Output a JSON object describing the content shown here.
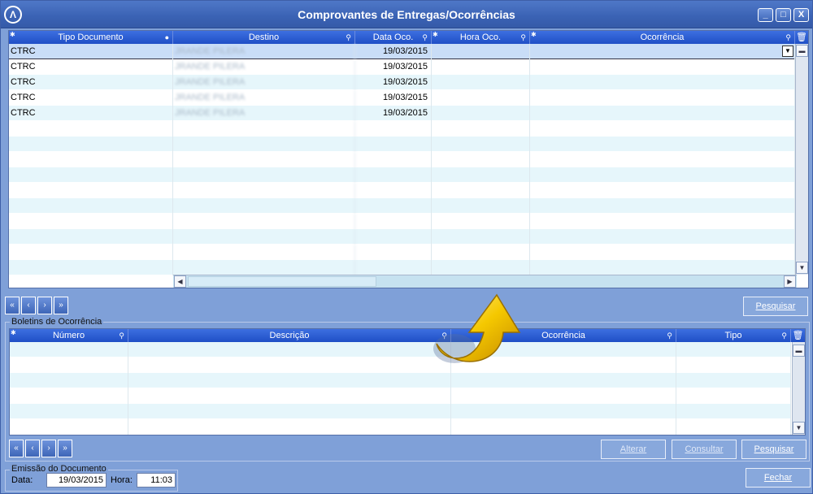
{
  "window": {
    "title": "Comprovantes de Entregas/Ocorrências",
    "app_icon": "Λ",
    "buttons": [
      "_",
      "□",
      "X"
    ]
  },
  "top_grid": {
    "columns": [
      "Tipo Documento",
      "Destino",
      "Data Oco.",
      "Hora Oco.",
      "Ocorrência"
    ],
    "rows": [
      {
        "tipo": "CTRC",
        "destino": "JRANDE PILERA",
        "data": "19/03/2015",
        "hora": "",
        "ocorrencia": ""
      },
      {
        "tipo": "CTRC",
        "destino": "JRANDE PILERA",
        "data": "19/03/2015",
        "hora": "",
        "ocorrencia": ""
      },
      {
        "tipo": "CTRC",
        "destino": "JRANDE PILERA",
        "data": "19/03/2015",
        "hora": "",
        "ocorrencia": ""
      },
      {
        "tipo": "CTRC",
        "destino": "JRANDE PILERA",
        "data": "19/03/2015",
        "hora": "",
        "ocorrencia": ""
      },
      {
        "tipo": "CTRC",
        "destino": "JRANDE PILERA",
        "data": "19/03/2015",
        "hora": "",
        "ocorrencia": ""
      }
    ],
    "empty_rows": 10
  },
  "nav": {
    "first": "«",
    "prev": "‹",
    "next": "›",
    "last": "»"
  },
  "pesquisar_top": "Pesquisar",
  "boletins": {
    "group_label": "Boletins de Ocorrência",
    "columns": [
      "Número",
      "Descrição",
      "Ocorrência",
      "Tipo"
    ],
    "empty_rows": 6
  },
  "actions": {
    "alterar": "Alterar",
    "consultar": "Consultar",
    "pesquisar": "Pesquisar",
    "fechar": "Fechar"
  },
  "emissao": {
    "group_label": "Emissão do Documento",
    "data_label": "Data:",
    "data_value": "19/03/2015",
    "hora_label": "Hora:",
    "hora_value": "11:03"
  },
  "colors": {
    "header": "#2a58cc",
    "row_alt": "#e6f6fb",
    "window_bg": "#7fa0d8",
    "arrow": "#f5c800"
  }
}
